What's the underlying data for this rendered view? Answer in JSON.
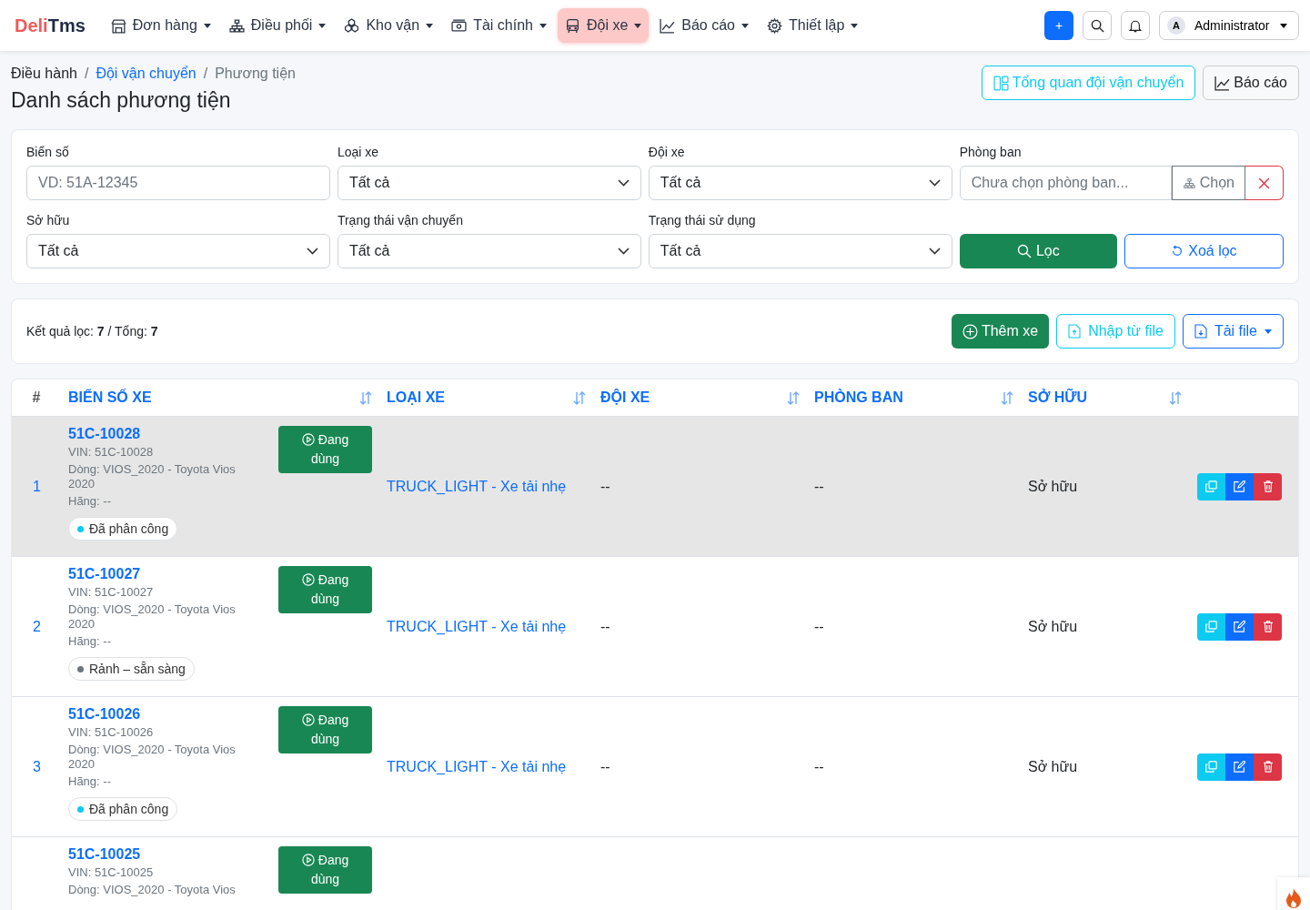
{
  "brand": {
    "part1": "Deli",
    "part2": "Tms"
  },
  "nav": [
    {
      "label": "Đơn hàng",
      "selected": false
    },
    {
      "label": "Điều phối",
      "selected": false
    },
    {
      "label": "Kho vận",
      "selected": false
    },
    {
      "label": "Tài chính",
      "selected": false
    },
    {
      "label": "Đội xe",
      "selected": true
    },
    {
      "label": "Báo cáo",
      "selected": false
    },
    {
      "label": "Thiết lập",
      "selected": false
    }
  ],
  "user": {
    "initial": "A",
    "name": "Administrator"
  },
  "add_button": "+",
  "breadcrumb": [
    {
      "label": "Điều hành",
      "kind": "plain"
    },
    {
      "separator": "/",
      "label": "Đội vận chuyển",
      "kind": "link"
    },
    {
      "separator": "/",
      "label": "Phương tiện",
      "kind": "current"
    }
  ],
  "page_title": "Danh sách phương tiện",
  "header_buttons": [
    {
      "label": "Tổng quan đội vận chuyển",
      "kind": "overview"
    },
    {
      "label": "Báo cáo",
      "kind": "report"
    }
  ],
  "filters": [
    {
      "label": "Biển số",
      "kind": "text",
      "placeholder": "VD: 51A-12345"
    },
    {
      "label": "Loại xe",
      "kind": "select",
      "value": "Tất cả"
    },
    {
      "label": "Đội xe",
      "kind": "select",
      "value": "Tất cả"
    },
    {
      "label": "Phòng ban",
      "kind": "picker",
      "placeholder": "Chưa chọn phòng ban...",
      "button": "Chọn"
    },
    {
      "label": "Sở hữu",
      "kind": "select",
      "value": "Tất cả"
    },
    {
      "label": "Trạng thái vận chuyển",
      "kind": "select",
      "value": "Tất cả"
    },
    {
      "label": "Trạng thái sử dụng",
      "kind": "select",
      "value": "Tất cả"
    }
  ],
  "filter_button": "Lọc",
  "clear_button": "Xoá lọc",
  "result": {
    "text": "Kết quả lọc: **7** / Tổng: **7**"
  },
  "actions": [
    {
      "label": "Thêm xe",
      "kind": "add"
    },
    {
      "label": "Nhập từ file",
      "kind": "import"
    },
    {
      "label": "Tải file",
      "kind": "download"
    }
  ],
  "table": {
    "columns": [
      "#",
      "BIỂN SỐ XE",
      "LOẠI XE",
      "ĐỘI XE",
      "PHÒNG BAN",
      "SỞ HỮU"
    ],
    "rows": [
      {
        "index": "1",
        "plate": "51C-10028",
        "vin": "VIN: 51C-10028",
        "model": "Dòng: VIOS_2020 - Toyota Vios 2020",
        "maker": "Hãng: --",
        "usage": "Đang dùng",
        "tag": "Đã phân công",
        "color": "#0dcaf0",
        "type": "TRUCK_LIGHT - Xe tải nhẹ",
        "team": "--",
        "department": "--",
        "owner": "Sở hữu",
        "selected": true
      },
      {
        "index": "2",
        "plate": "51C-10027",
        "vin": "VIN: 51C-10027",
        "model": "Dòng: VIOS_2020 - Toyota Vios 2020",
        "maker": "Hãng: --",
        "usage": "Đang dùng",
        "tag": "Rảnh – sẵn sàng",
        "color": "#6c757d",
        "type": "TRUCK_LIGHT - Xe tải nhẹ",
        "team": "--",
        "department": "--",
        "owner": "Sở hữu",
        "selected": false
      },
      {
        "index": "3",
        "plate": "51C-10026",
        "vin": "VIN: 51C-10026",
        "model": "Dòng: VIOS_2020 - Toyota Vios 2020",
        "maker": "Hãng: --",
        "usage": "Đang dùng",
        "tag": "Đã phân công",
        "color": "#0dcaf0",
        "type": "TRUCK_LIGHT - Xe tải nhẹ",
        "team": "--",
        "department": "--",
        "owner": "Sở hữu",
        "selected": false
      },
      {
        "plate": "51C-10025",
        "vin": "VIN: 51C-10025",
        "model": "Dòng: VIOS_2020 - Toyota Vios",
        "usage": "Đang dùng",
        "selected": false
      }
    ]
  }
}
